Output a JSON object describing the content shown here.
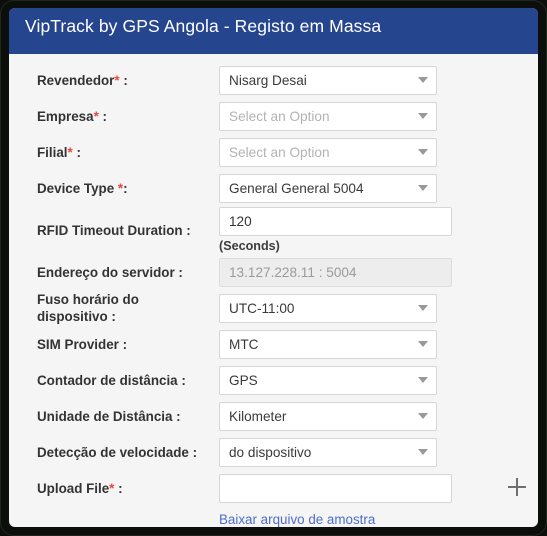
{
  "window": {
    "frame_color": "#0b0e0b",
    "panel_bg": "#f5f5f5"
  },
  "header": {
    "title": "VipTrack by GPS Angola - Registo em Massa",
    "bg_color": "#26458f",
    "text_color": "#ffffff"
  },
  "colors": {
    "required_asterisk": "#e8453c",
    "link": "#4d6ec7",
    "label": "#333333",
    "placeholder": "#b3b3b3",
    "input_border": "#d6d6d6",
    "disabled_bg": "#ededed"
  },
  "form": {
    "rows": [
      {
        "id": "revendedor",
        "label": "Revendedor",
        "required": true,
        "suffix": " :",
        "control": "select",
        "value": "Nisarg Desai",
        "is_placeholder": false
      },
      {
        "id": "empresa",
        "label": "Empresa",
        "required": true,
        "suffix": " :",
        "control": "select",
        "value": "Select an Option",
        "is_placeholder": true
      },
      {
        "id": "filial",
        "label": "Filial",
        "required": true,
        "suffix": " :",
        "control": "select",
        "value": "Select an Option",
        "is_placeholder": true
      },
      {
        "id": "device-type",
        "label": "Device Type ",
        "required": true,
        "suffix": ":",
        "control": "select",
        "value": "General General 5004",
        "is_placeholder": false
      },
      {
        "id": "rfid-timeout-duration",
        "label": "RFID Timeout Duration ",
        "required": false,
        "suffix": ":",
        "control": "text",
        "value": "120",
        "hint": "(Seconds)"
      },
      {
        "id": "endereco-do-servidor",
        "label": "Endereço do servidor ",
        "required": false,
        "suffix": ":",
        "control": "text-disabled",
        "value": "13.127.228.11 : 5004"
      },
      {
        "id": "fuso-horario-do-dispositivo",
        "label": "Fuso horário do dispositivo ",
        "required": false,
        "suffix": ":",
        "control": "select",
        "value": "UTC-11:00",
        "is_placeholder": false
      },
      {
        "id": "sim-provider",
        "label": "SIM Provider ",
        "required": false,
        "suffix": ":",
        "control": "select",
        "value": "MTC",
        "is_placeholder": false
      },
      {
        "id": "contador-de-distancia",
        "label": "Contador de distância ",
        "required": false,
        "suffix": ":",
        "control": "select",
        "value": "GPS",
        "is_placeholder": false
      },
      {
        "id": "unidade-de-distancia",
        "label": "Unidade de Distância ",
        "required": false,
        "suffix": ":",
        "control": "select",
        "value": "Kilometer",
        "is_placeholder": false
      },
      {
        "id": "deteccao-de-velocidade",
        "label": "Detecção de velocidade ",
        "required": false,
        "suffix": ":",
        "control": "select",
        "value": "do dispositivo",
        "is_placeholder": false
      },
      {
        "id": "upload-file",
        "label": "Upload File",
        "required": true,
        "suffix": " :",
        "control": "text",
        "value": ""
      }
    ],
    "sample_file_link": "Baixar arquivo de amostra",
    "add_icon": "plus-icon"
  }
}
